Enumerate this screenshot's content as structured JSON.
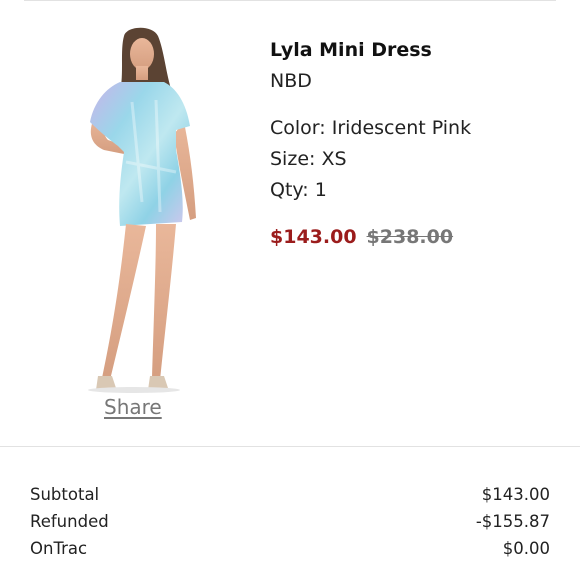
{
  "item": {
    "name": "Lyla Mini Dress",
    "brand": "NBD",
    "color_line": "Color: Iridescent Pink",
    "size_line": "Size: XS",
    "qty_line": "Qty: 1",
    "sale_price": "$143.00",
    "original_price": "$238.00",
    "share_label": "Share"
  },
  "summary": [
    {
      "label": "Subtotal",
      "value": "$143.00"
    },
    {
      "label": "Refunded",
      "value": "-$155.87"
    },
    {
      "label": "OnTrac",
      "value": "$0.00"
    }
  ],
  "colors": {
    "sale_price": "#9b1c1c",
    "original_price": "#777777",
    "dress": "#9fd6e6"
  }
}
